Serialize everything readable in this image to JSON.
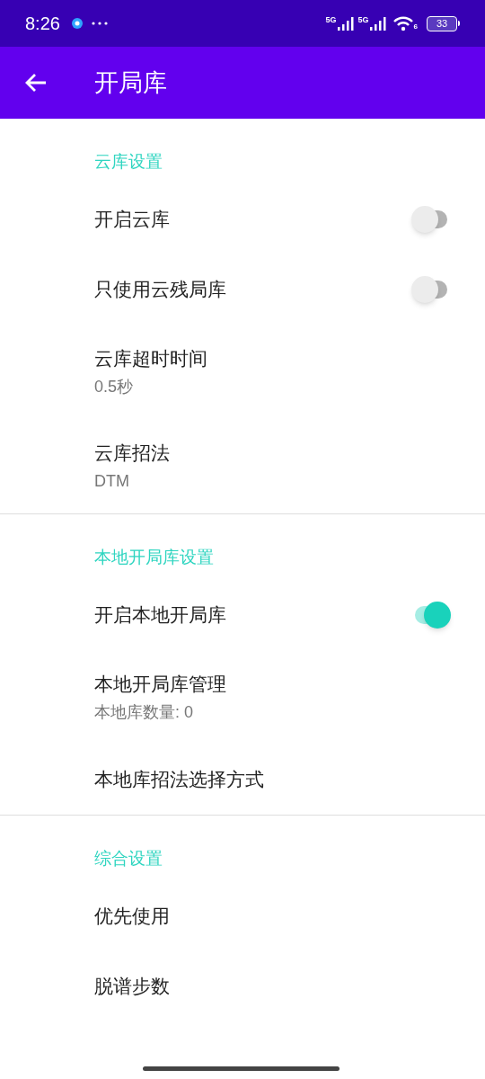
{
  "status_bar": {
    "time": "8:26",
    "battery": "33",
    "network_1": "5G",
    "network_2": "5G",
    "wifi_badge": "6"
  },
  "app_bar": {
    "title": "开局库"
  },
  "sections": [
    {
      "title": "云库设置",
      "items": [
        {
          "kind": "switch",
          "title": "开启云库",
          "on": false
        },
        {
          "kind": "switch",
          "title": "只使用云残局库",
          "on": false
        },
        {
          "kind": "value",
          "title": "云库超时时间",
          "summary": "0.5秒"
        },
        {
          "kind": "value",
          "title": "云库招法",
          "summary": "DTM"
        }
      ]
    },
    {
      "title": "本地开局库设置",
      "items": [
        {
          "kind": "switch",
          "title": "开启本地开局库",
          "on": true
        },
        {
          "kind": "value",
          "title": "本地开局库管理",
          "summary": "本地库数量: 0"
        },
        {
          "kind": "plain",
          "title": "本地库招法选择方式"
        }
      ]
    },
    {
      "title": "综合设置",
      "items": [
        {
          "kind": "plain",
          "title": "优先使用"
        },
        {
          "kind": "plain",
          "title": "脱谱步数"
        }
      ]
    }
  ]
}
